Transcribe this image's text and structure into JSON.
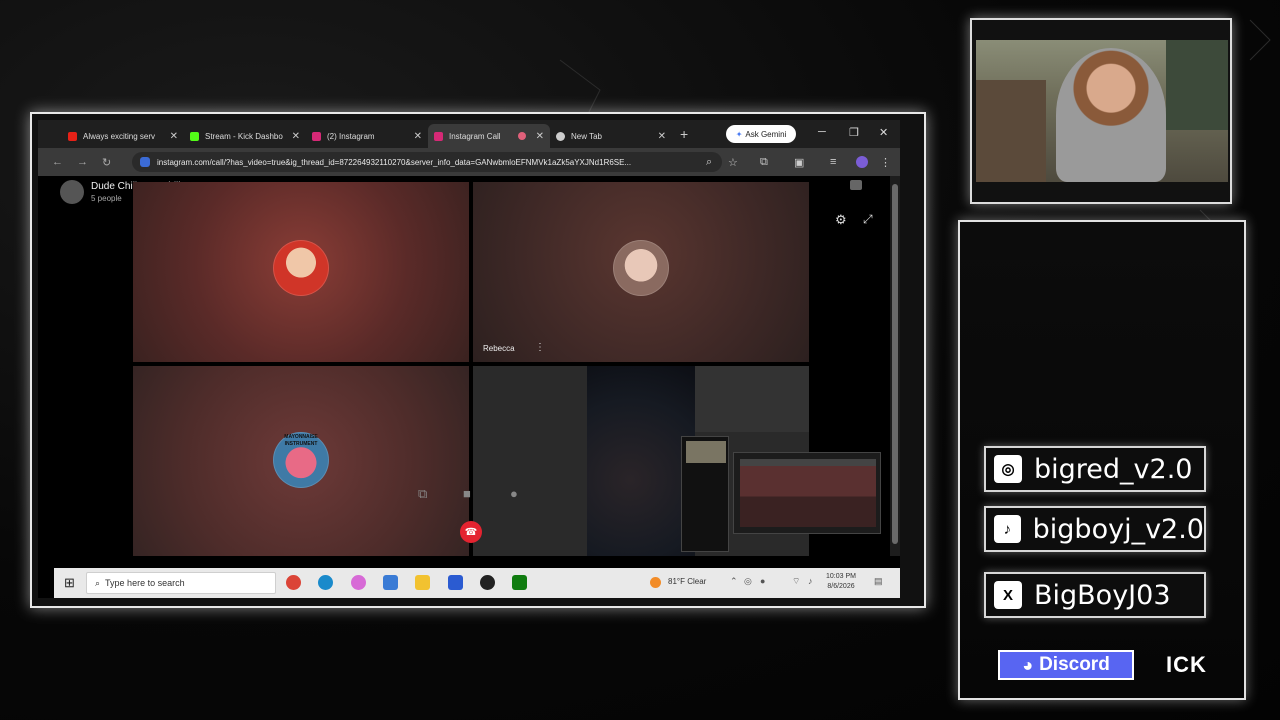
{
  "browser": {
    "tabs": [
      {
        "label": "Always exciting serv",
        "color": "#e62117"
      },
      {
        "label": "Stream - Kick Dashbo",
        "color": "#53fc18"
      },
      {
        "label": "(2) Instagram",
        "color": "#d62976"
      },
      {
        "label": "Instagram Call",
        "color": "#d62976",
        "active": true
      },
      {
        "label": "New Tab",
        "color": "#cccccc"
      }
    ],
    "new_tab_glyph": "+",
    "gemini_label": "Ask Gemini",
    "url": "instagram.com/call/?has_video=true&ig_thread_id=872264932110270&server_info_data=GANwbmloEFNMVk1aZk5aYXJNd1R6SE..."
  },
  "call": {
    "conversation_title": "Dude Chill Just Chill",
    "conversation_subtitle": "5 people",
    "participant_name": "Rebecca",
    "tile3_overlay_text": "MAYONNAISE INSTRUMENT"
  },
  "taskbar": {
    "search_placeholder": "Type here to search",
    "weather": "81°F  Clear",
    "time": "10:03 PM",
    "date": "8/6/2026"
  },
  "socials": [
    {
      "platform": "instagram",
      "icon": "instagram-icon",
      "handle": "bigred_v2.0"
    },
    {
      "platform": "tiktok",
      "icon": "tiktok-icon",
      "handle": "bigboyj_v2.0"
    },
    {
      "platform": "x",
      "icon": "x-icon",
      "handle": "BigBoyJ03"
    }
  ],
  "discord_label": "Discord",
  "kick_label": "ICK",
  "colors": {
    "accent_frame": "#e8e8e8",
    "discord": "#5865f2",
    "end_call": "#e42330"
  }
}
